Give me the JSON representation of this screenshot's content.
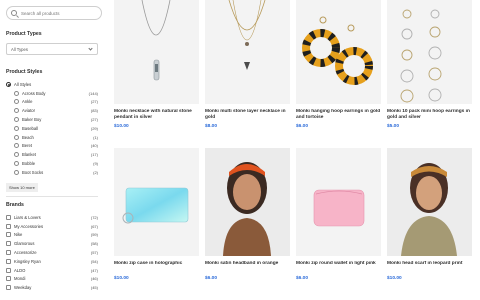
{
  "search": {
    "placeholder": "Search all products"
  },
  "product_types": {
    "title": "Product Types",
    "selected": "All Types"
  },
  "product_styles": {
    "title": "Product Styles",
    "all_label": "All Styles",
    "items": [
      {
        "label": "Across Body",
        "count": "(144)"
      },
      {
        "label": "Ankle",
        "count": "(27)"
      },
      {
        "label": "Aviator",
        "count": "(83)"
      },
      {
        "label": "Baker Boy",
        "count": "(27)"
      },
      {
        "label": "Baseball",
        "count": "(29)"
      },
      {
        "label": "Beach",
        "count": "(1)"
      },
      {
        "label": "Beret",
        "count": "(40)"
      },
      {
        "label": "Blanket",
        "count": "(17)"
      },
      {
        "label": "Bobble",
        "count": "(9)"
      },
      {
        "label": "Boot Socks",
        "count": "(2)"
      }
    ],
    "show_more": "Show 10 more"
  },
  "brands": {
    "title": "Brands",
    "items": [
      {
        "label": "Liars & Lovers",
        "count": "(72)"
      },
      {
        "label": "My Accessories",
        "count": "(67)"
      },
      {
        "label": "Nike",
        "count": "(59)"
      },
      {
        "label": "Glamorous",
        "count": "(58)"
      },
      {
        "label": "Accessorize",
        "count": "(57)"
      },
      {
        "label": "Kingsley Ryan",
        "count": "(54)"
      },
      {
        "label": "ALDO",
        "count": "(47)"
      },
      {
        "label": "Mondi",
        "count": "(46)"
      },
      {
        "label": "Weekday",
        "count": "(45)"
      }
    ]
  },
  "products": [
    {
      "name": "Monki necklace with natural stone pendant in silver",
      "price": "$10.00"
    },
    {
      "name": "Monki multi stone layer necklace in gold",
      "price": "$8.00"
    },
    {
      "name": "Monki hanging hoop earrings in gold and tortoise",
      "price": "$6.00"
    },
    {
      "name": "Monki 10 pack mini hoop earrings in gold and silver",
      "price": "$5.00"
    },
    {
      "name": "Monki zip case in holographic",
      "price": "$10.00"
    },
    {
      "name": "Monki satin headband in orange",
      "price": "$6.00"
    },
    {
      "name": "Monki zip round wallet in light pink",
      "price": "$6.00"
    },
    {
      "name": "Monki head scarf in leopard print",
      "price": "$10.00"
    }
  ],
  "colors": {
    "accent": "#2a6ad9",
    "text": "#2d2d2d",
    "image_bg": "#f3f3f3"
  },
  "icons": {
    "search": "search-icon",
    "dropdown": "chevron-down-icon"
  }
}
